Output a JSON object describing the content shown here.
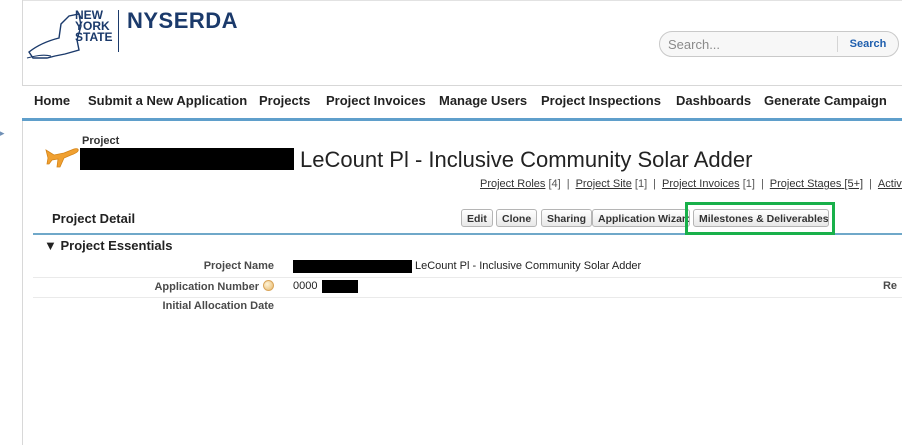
{
  "brand": {
    "state_lines": [
      "NEW",
      "YORK",
      "STATE"
    ],
    "name": "NYSERDA"
  },
  "search": {
    "placeholder": "Search...",
    "button_label": "Search"
  },
  "nav": {
    "items": [
      {
        "label": "Home"
      },
      {
        "label": "Submit a New Application"
      },
      {
        "label": "Projects"
      },
      {
        "label": "Project Invoices"
      },
      {
        "label": "Manage Users"
      },
      {
        "label": "Project Inspections"
      },
      {
        "label": "Dashboards"
      },
      {
        "label": "Generate Campaign"
      }
    ]
  },
  "sidebar_toggle": "▸",
  "project": {
    "breadcrumb": "Project",
    "title": "LeCount Pl - Inclusive Community Solar Adder",
    "related_links": [
      {
        "label": "Project Roles",
        "count": "[4]"
      },
      {
        "label": "Project Site",
        "count": "[1]"
      },
      {
        "label": "Project Invoices",
        "count": "[1]"
      },
      {
        "label": "Project Stages",
        "count": "[5+]"
      },
      {
        "label": "Activity",
        "count": ""
      }
    ],
    "link_separator": "|"
  },
  "detail": {
    "title": "Project Detail",
    "buttons": {
      "edit": "Edit",
      "clone": "Clone",
      "sharing": "Sharing",
      "application_wizard": "Application Wizard",
      "milestones": "Milestones & Deliverables"
    }
  },
  "essentials": {
    "section_title": "▼ Project Essentials",
    "fields": [
      {
        "label": "Project Name",
        "value": "LeCount Pl - Inclusive Community Solar Adder"
      },
      {
        "label": "Application Number",
        "value": "0000"
      },
      {
        "label": "Initial Allocation Date",
        "value": ""
      }
    ],
    "right_cut_label": "Re"
  },
  "colors": {
    "brand_navy": "#1b3a6b",
    "nav_underline": "#5f9fcb",
    "highlight_green": "#18b04a",
    "search_button": "#1f5fae"
  },
  "icons": {
    "project_icon": "airplane-icon",
    "logo_shape": "new-york-state-outline-icon",
    "help": "help-bubble-icon"
  }
}
